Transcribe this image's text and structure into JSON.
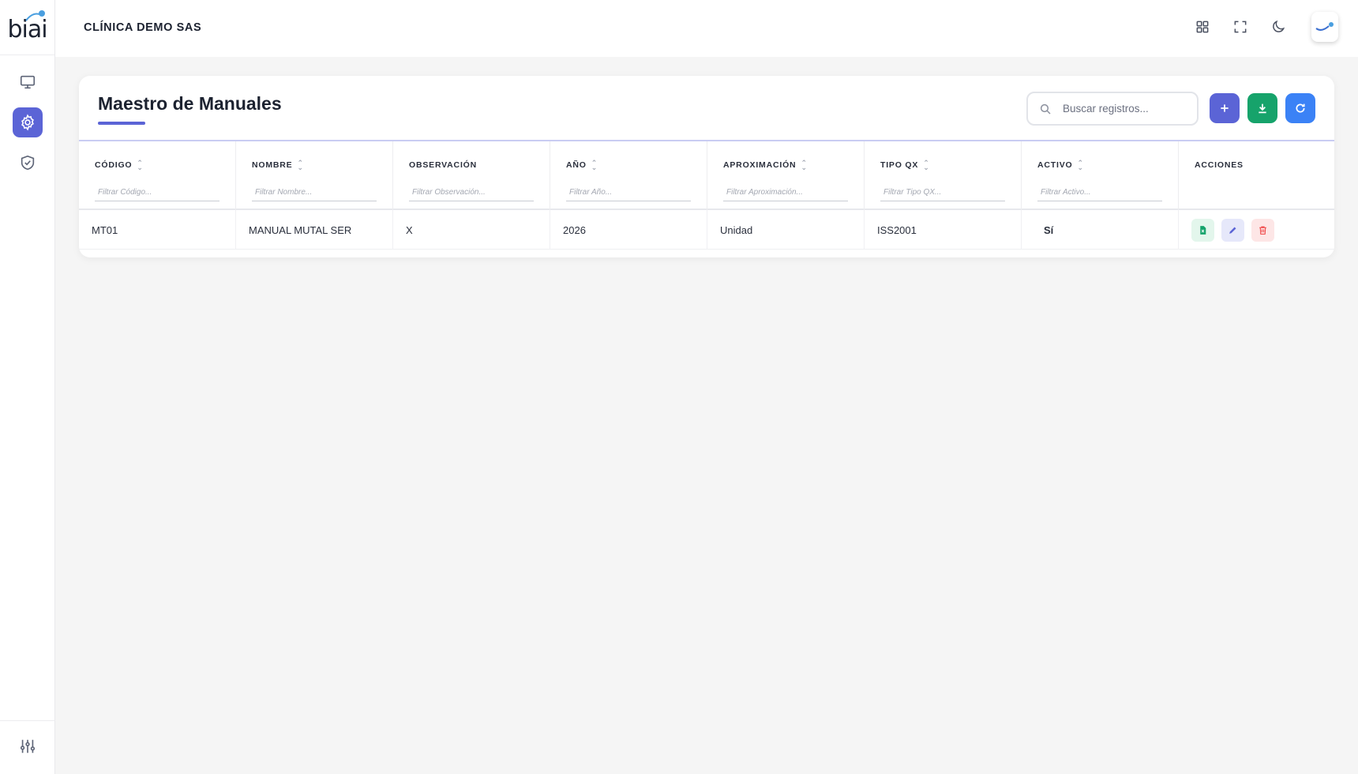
{
  "app": {
    "logo_text": "biai",
    "company": "CLÍNICA DEMO SAS"
  },
  "sidebar": {
    "items": [
      {
        "name": "monitor",
        "icon": "monitor-icon",
        "active": false
      },
      {
        "name": "settings",
        "icon": "gear-icon",
        "active": true
      },
      {
        "name": "security",
        "icon": "shield-check-icon",
        "active": false
      }
    ],
    "bottom_icon": "sliders-icon"
  },
  "topbar": {
    "icons": [
      "grid-icon",
      "fullscreen-icon",
      "moon-icon"
    ],
    "avatar_icon": "user-avatar"
  },
  "page": {
    "title": "Maestro de Manuales",
    "search_placeholder": "Buscar registros...",
    "buttons": {
      "add": {
        "icon": "plus-icon",
        "color": "#5b64d6"
      },
      "export": {
        "icon": "download-icon",
        "color": "#16a36b"
      },
      "refresh": {
        "icon": "refresh-icon",
        "color": "#3b82f6"
      }
    }
  },
  "table": {
    "columns": [
      {
        "label": "CÓDIGO",
        "sortable": true,
        "filter_placeholder": "Filtrar Código..."
      },
      {
        "label": "NOMBRE",
        "sortable": true,
        "filter_placeholder": "Filtrar Nombre..."
      },
      {
        "label": "OBSERVACIÓN",
        "sortable": false,
        "filter_placeholder": "Filtrar Observación..."
      },
      {
        "label": "AÑO",
        "sortable": true,
        "filter_placeholder": "Filtrar Año..."
      },
      {
        "label": "APROXIMACIÓN",
        "sortable": true,
        "filter_placeholder": "Filtrar Aproximación..."
      },
      {
        "label": "TIPO QX",
        "sortable": true,
        "filter_placeholder": "Filtrar Tipo QX..."
      },
      {
        "label": "ACTIVO",
        "sortable": true,
        "filter_placeholder": "Filtrar Activo..."
      },
      {
        "label": "ACCIONES",
        "sortable": false,
        "filter_placeholder": ""
      }
    ],
    "rows": [
      {
        "codigo": "MT01",
        "nombre": "MANUAL MUTAL SER",
        "observacion": "X",
        "anio": "2026",
        "aproximacion": "Unidad",
        "tipo_qx": "ISS2001",
        "activo": "Sí"
      }
    ],
    "row_actions": [
      {
        "name": "excel",
        "icon": "file-excel-icon",
        "bg": "#e3f6ec",
        "fg": "#16a36b"
      },
      {
        "name": "edit",
        "icon": "pencil-icon",
        "bg": "#e6e8fa",
        "fg": "#5b64d6"
      },
      {
        "name": "delete",
        "icon": "trash-icon",
        "bg": "#fde6e6",
        "fg": "#ef4444"
      }
    ]
  }
}
